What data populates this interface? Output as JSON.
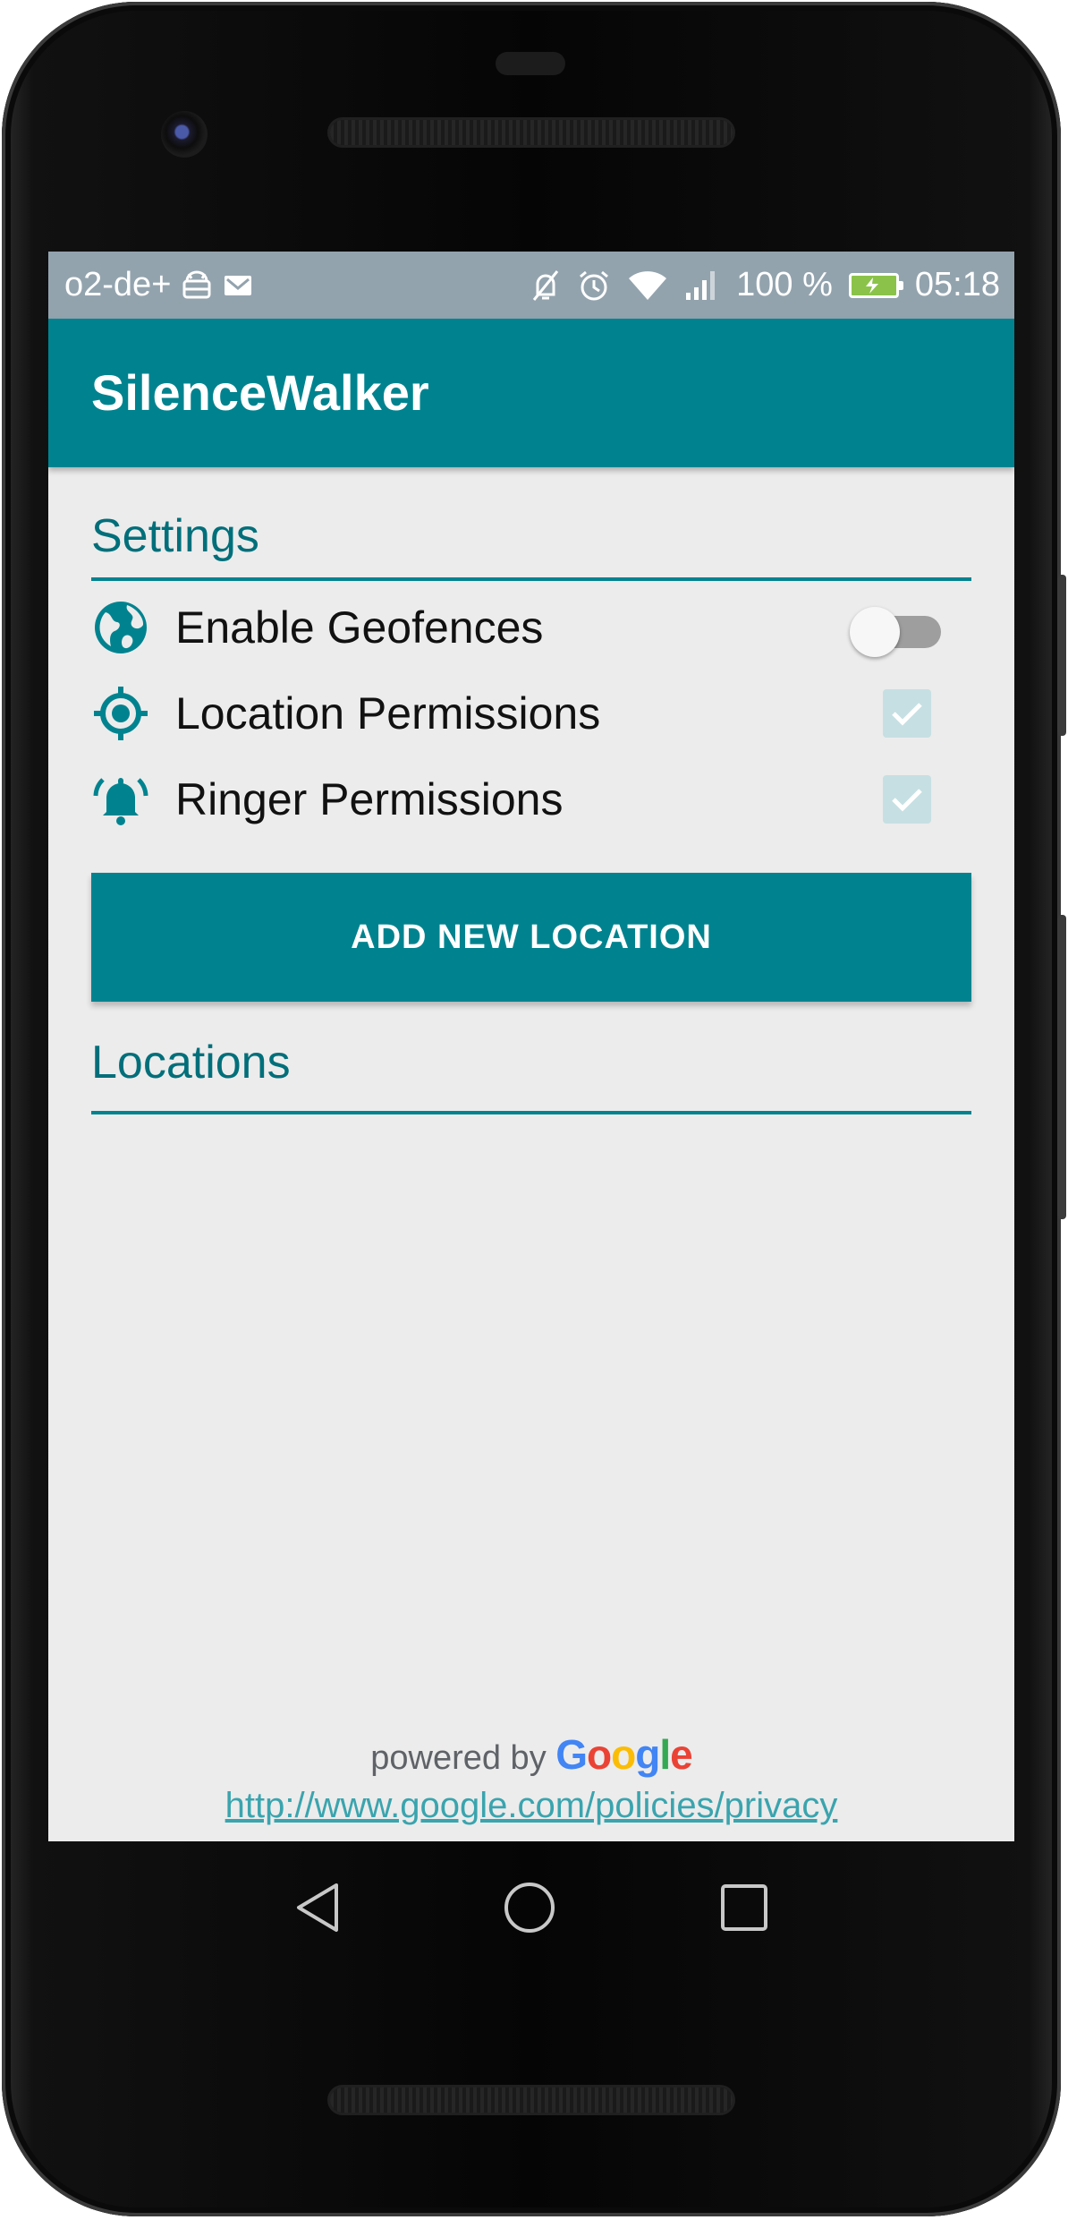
{
  "status_bar": {
    "carrier": "o2-de+",
    "battery_text": "100 %",
    "time": "05:18",
    "left_icons": [
      "android-icon",
      "mail-icon"
    ],
    "right_icons": [
      "mute-icon",
      "alarm-icon",
      "wifi-icon",
      "signal-icon",
      "battery-charging-icon"
    ]
  },
  "app_bar": {
    "title": "SilenceWalker"
  },
  "settings": {
    "title": "Settings",
    "items": [
      {
        "label": "Enable Geofences",
        "icon": "globe-icon",
        "control": "switch",
        "checked": false
      },
      {
        "label": "Location Permissions",
        "icon": "location-target-icon",
        "control": "checkbox",
        "checked": true
      },
      {
        "label": "Ringer Permissions",
        "icon": "bell-ringing-icon",
        "control": "checkbox",
        "checked": true
      }
    ]
  },
  "add_button": {
    "label": "ADD NEW LOCATION"
  },
  "locations": {
    "title": "Locations",
    "items": []
  },
  "footer": {
    "powered_by": "powered by",
    "brand": "Google",
    "privacy_link": "http://www.google.com/policies/privacy"
  },
  "nav_bar": {
    "buttons": [
      "back-icon",
      "home-icon",
      "recents-icon"
    ]
  },
  "colors": {
    "primary": "#00838f",
    "status_bar": "#93a3ae",
    "background": "#ececec",
    "checkbox_disabled": "#c6dfe2",
    "link": "#3aa4ae"
  }
}
